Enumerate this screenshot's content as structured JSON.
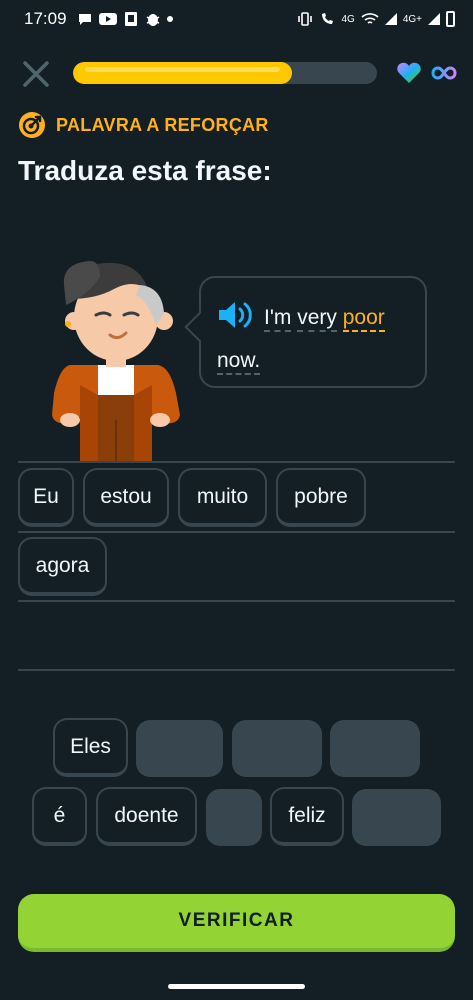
{
  "status_bar": {
    "time": "17:09",
    "left_icons": [
      "message-icon",
      "youtube-icon",
      "app-icon",
      "bug-icon",
      "dot-icon"
    ],
    "right_icons": [
      "vibrate-icon",
      "wifi-call-icon",
      "wifi-off-icon",
      "signal-icon",
      "signal-4g-icon",
      "battery-icon"
    ],
    "net_label_1": "4G",
    "net_label_2": "4G+"
  },
  "top_bar": {
    "progress_fraction": 0.72,
    "accent_color": "#ffc800",
    "hearts_icon": "gem-heart-icon",
    "hearts_value_icon": "infinity-icon"
  },
  "lesson": {
    "tag_label": "PALAVRA A REFORÇAR",
    "title": "Traduza esta frase:"
  },
  "prompt": {
    "words": [
      "I'm",
      "very",
      "poor",
      "now."
    ],
    "highlighted_word": "poor"
  },
  "answer": {
    "row1": [
      "Eu",
      "estou",
      "muito",
      "pobre"
    ],
    "row2": [
      "agora"
    ]
  },
  "bank": {
    "row1": [
      "Eles"
    ],
    "row2": [
      "é",
      "doente",
      "feliz"
    ]
  },
  "verify_label": "VERIFICAR",
  "colors": {
    "background": "#131f24",
    "border": "#37464f",
    "tag": "#ffb020",
    "button": "#93d333",
    "speaker": "#1cb0f6"
  }
}
